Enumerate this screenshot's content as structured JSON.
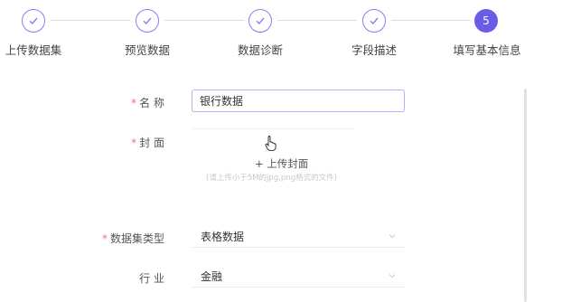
{
  "stepper": {
    "steps": [
      {
        "label": "上传数据集",
        "status": "done"
      },
      {
        "label": "预览数据",
        "status": "done"
      },
      {
        "label": "数据诊断",
        "status": "done"
      },
      {
        "label": "字段描述",
        "status": "done"
      },
      {
        "label": "填写基本信息",
        "status": "active",
        "number": "5"
      }
    ]
  },
  "form": {
    "name": {
      "label": "名 称",
      "value": "银行数据"
    },
    "cover": {
      "label": "封 面",
      "upload_label": "+ 上传封面",
      "hint": "(请上传小于5M的jpg,png格式的文件)"
    },
    "dataset_type": {
      "label": "数据集类型",
      "value": "表格数据"
    },
    "industry": {
      "label": "行 业",
      "value": "金融"
    }
  },
  "colors": {
    "accent": "#6b5ce7",
    "required": "#f56c6c"
  }
}
